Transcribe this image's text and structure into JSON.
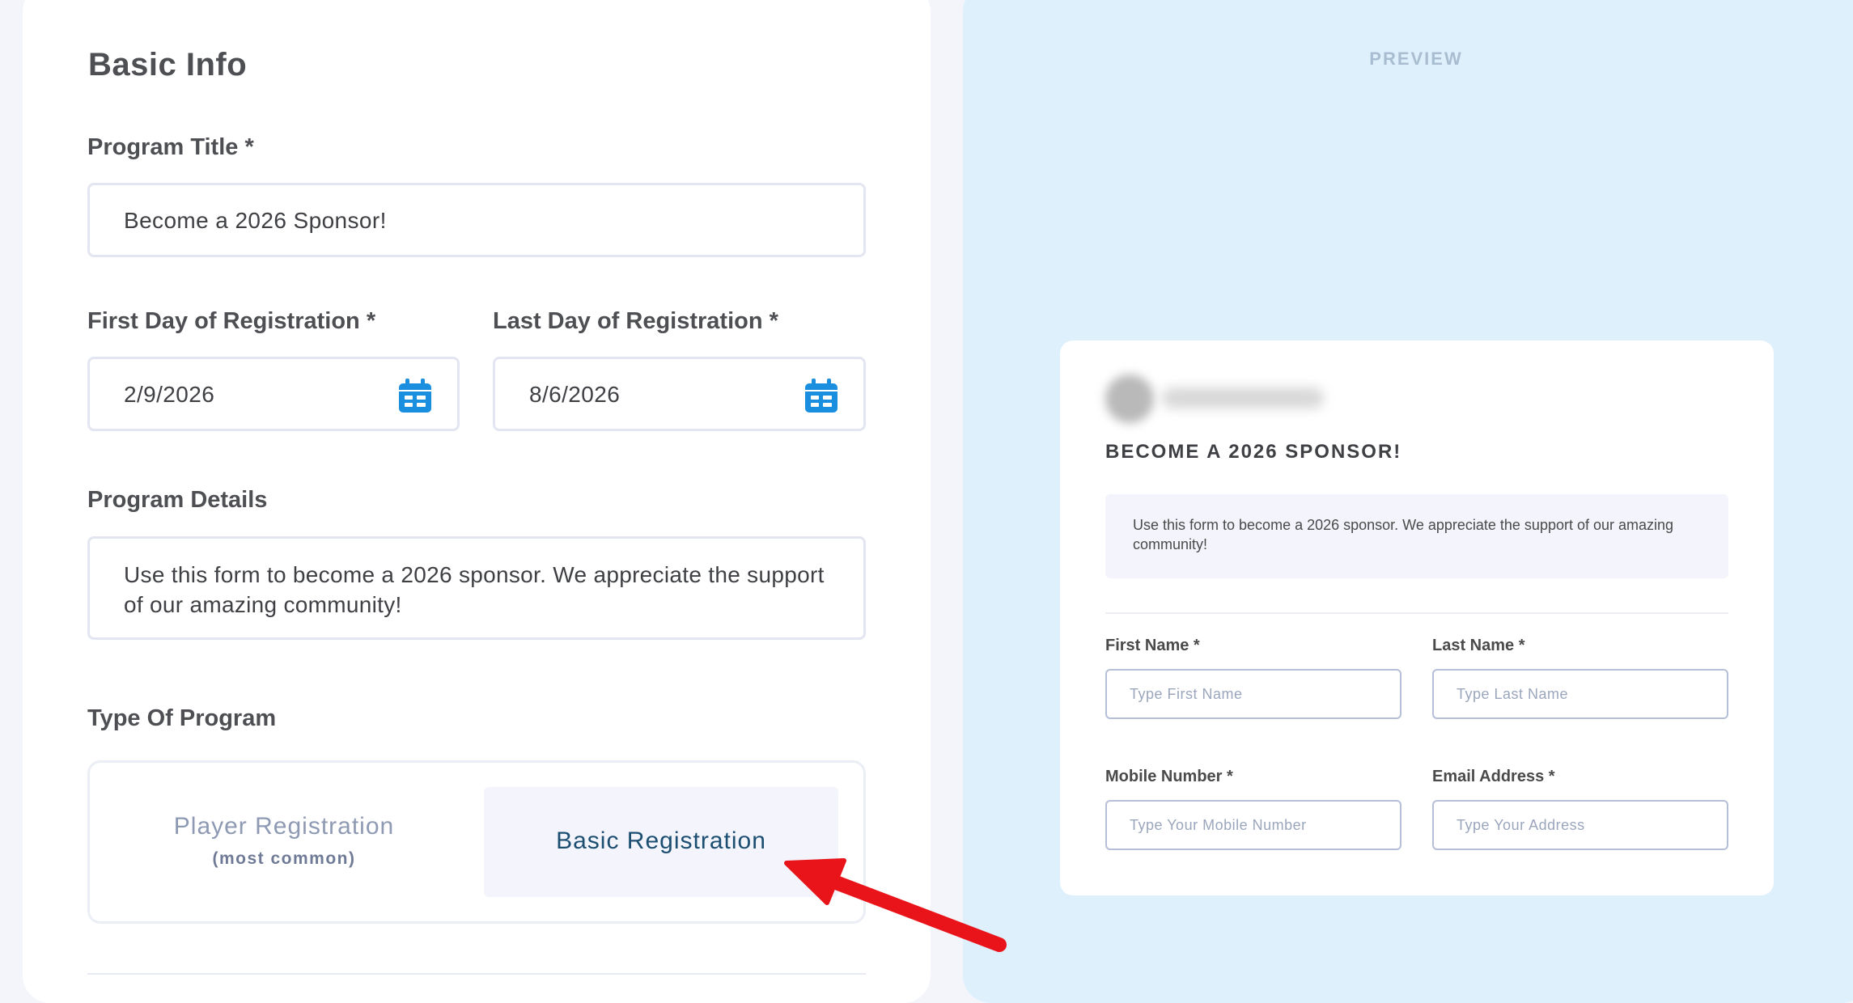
{
  "basic_info": {
    "title": "Basic Info",
    "program_title_label": "Program Title *",
    "program_title_value": "Become a 2026 Sponsor!",
    "first_day_label": "First Day of Registration *",
    "first_day_value": "2/9/2026",
    "last_day_label": "Last Day of Registration *",
    "last_day_value": "8/6/2026",
    "details_label": "Program Details",
    "details_value": "Use this form to become a 2026 sponsor. We appreciate the support of our amazing community!",
    "type_label": "Type Of Program",
    "type_options": [
      {
        "label": "Player Registration",
        "sublabel": "(most common)",
        "selected": false
      },
      {
        "label": "Basic Registration",
        "selected": true
      }
    ],
    "calendar_icon_color": "#1a8fdf"
  },
  "preview": {
    "header": "PREVIEW",
    "form_title": "BECOME A 2026 SPONSOR!",
    "description": "Use this form to become a 2026 sponsor. We appreciate the support of our amazing community!",
    "fields": [
      {
        "label": "First Name *",
        "placeholder": "Type First Name"
      },
      {
        "label": "Last Name *",
        "placeholder": "Type Last Name"
      },
      {
        "label": "Mobile Number *",
        "placeholder": "Type Your Mobile Number"
      },
      {
        "label": "Email Address *",
        "placeholder": "Type Your Address"
      }
    ]
  },
  "annotation": {
    "arrow_icon": "red-arrow-icon",
    "color": "#e8141a"
  }
}
